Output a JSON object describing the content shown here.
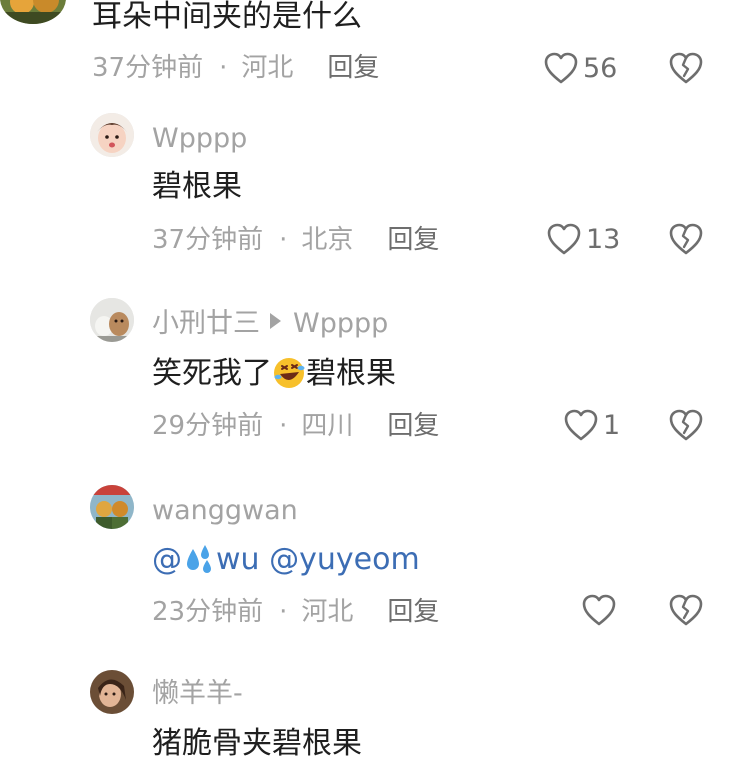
{
  "comments": [
    {
      "text": "耳朵中间夹的是什么",
      "time": "37分钟前",
      "location": "河北",
      "reply_label": "回复",
      "likes": "56"
    },
    {
      "username": "Wpppp",
      "text": "碧根果",
      "time": "37分钟前",
      "location": "北京",
      "reply_label": "回复",
      "likes": "13"
    },
    {
      "username": "小刑廿三",
      "reply_to": "Wpppp",
      "text_before": "笑死我了",
      "emoji": "rolling-laughing-emoji",
      "text_after": "碧根果",
      "time": "29分钟前",
      "location": "四川",
      "reply_label": "回复",
      "likes": "1"
    },
    {
      "username": "wanggwan",
      "mention_1_prefix": "@",
      "mention_1_emoji": "sweat-droplets-emoji",
      "mention_1_name": "wu",
      "mention_2": "@yuyeom",
      "time": "23分钟前",
      "location": "河北",
      "reply_label": "回复",
      "likes": ""
    },
    {
      "username": "懒羊羊-",
      "text": "猪脆骨夹碧根果"
    }
  ],
  "separator": "·",
  "colors": {
    "text_primary": "#1f1f1f",
    "text_secondary": "#a3a3a3",
    "mention": "#3c6db4"
  }
}
